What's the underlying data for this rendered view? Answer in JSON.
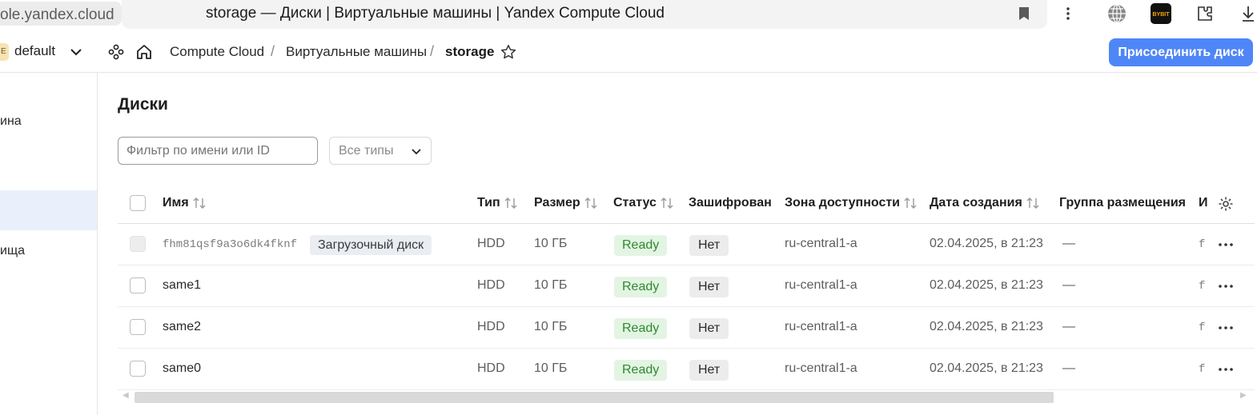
{
  "browser": {
    "url": "ole.yandex.cloud",
    "page_title": "storage — Диски | Виртуальные машины | Yandex Compute Cloud",
    "icons": [
      "bookmark-icon",
      "kebab-menu-icon",
      "globe-icon",
      "bybit-extension-icon",
      "extensions-icon",
      "download-icon"
    ],
    "bybit_label": "BYBIT"
  },
  "header": {
    "folder_avatar": "E",
    "folder_name": "default",
    "breadcrumbs": [
      "Compute Cloud",
      "Виртуальные машины",
      "storage"
    ],
    "separator": "/",
    "attach_button": "Присоединить диск"
  },
  "sidebar": {
    "items": [
      "ина",
      "ища"
    ]
  },
  "main": {
    "title": "Диски",
    "filter_placeholder": "Фильтр по имени или ID",
    "type_select": "Все типы"
  },
  "table": {
    "columns": {
      "name": "Имя",
      "type": "Тип",
      "size": "Размер",
      "status": "Статус",
      "encrypted": "Зашифрован",
      "zone": "Зона доступности",
      "created": "Дата создания",
      "placement": "Группа размещения",
      "truncated": "И"
    },
    "rows": [
      {
        "name": "fhm81qsf9a3o6dk4fknf",
        "badge": "Загрузочный диск",
        "type": "HDD",
        "size": "10 ГБ",
        "status": "Ready",
        "encrypted": "Нет",
        "zone": "ru-central1-a",
        "created": "02.04.2025, в 21:23",
        "placement": "—",
        "extra": "f"
      },
      {
        "name": "same1",
        "type": "HDD",
        "size": "10 ГБ",
        "status": "Ready",
        "encrypted": "Нет",
        "zone": "ru-central1-a",
        "created": "02.04.2025, в 21:23",
        "placement": "—",
        "extra": "f"
      },
      {
        "name": "same2",
        "type": "HDD",
        "size": "10 ГБ",
        "status": "Ready",
        "encrypted": "Нет",
        "zone": "ru-central1-a",
        "created": "02.04.2025, в 21:23",
        "placement": "—",
        "extra": "f"
      },
      {
        "name": "same0",
        "type": "HDD",
        "size": "10 ГБ",
        "status": "Ready",
        "encrypted": "Нет",
        "zone": "ru-central1-a",
        "created": "02.04.2025, в 21:23",
        "placement": "—",
        "extra": "f"
      }
    ]
  },
  "colors": {
    "accent": "#4f86f7",
    "status_ready_bg": "#e3f4e3",
    "status_ready_text": "#2f8a2f",
    "sidebar_active": "#eaf0fb"
  }
}
